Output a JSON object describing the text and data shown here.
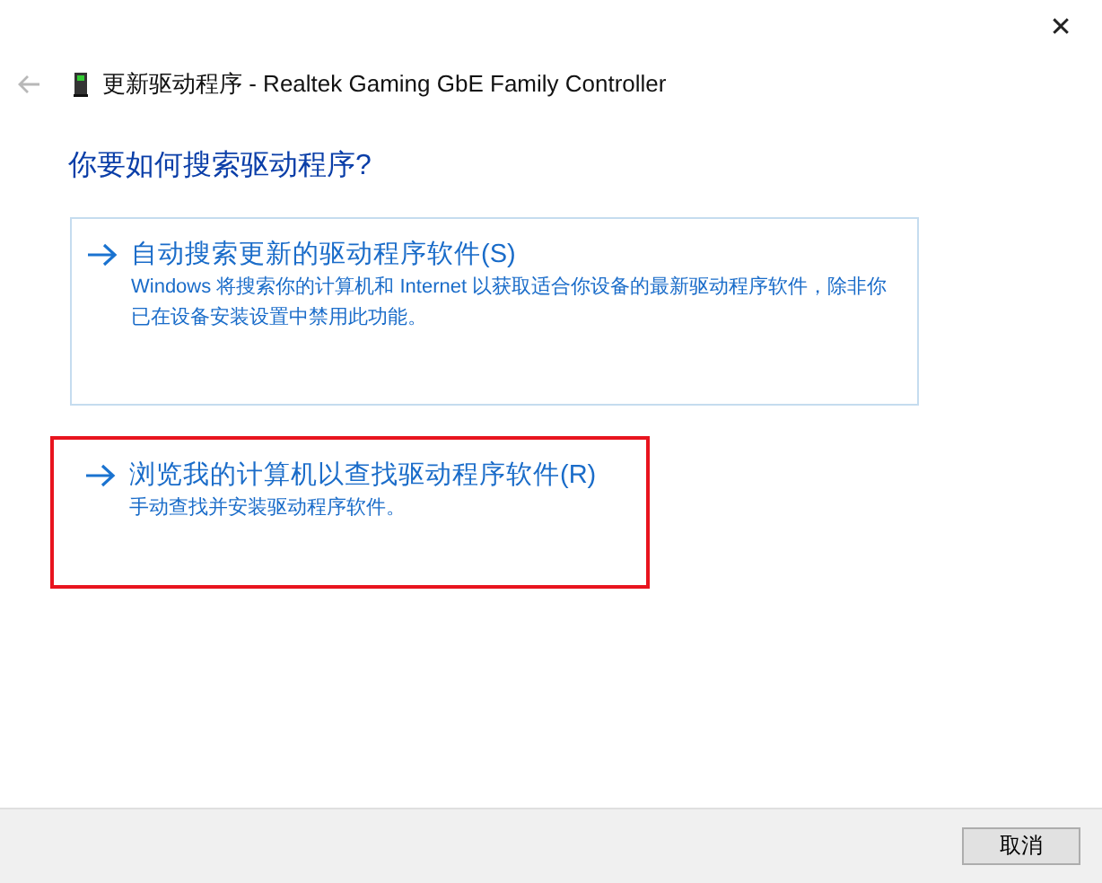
{
  "window": {
    "title": "更新驱动程序 - Realtek Gaming GbE Family Controller",
    "close": "✕"
  },
  "heading": "你要如何搜索驱动程序?",
  "options": [
    {
      "kind": "hover",
      "title": "自动搜索更新的驱动程序软件(S)",
      "description": "Windows 将搜索你的计算机和 Internet 以获取适合你设备的最新驱动程序软件，除非你已在设备安装设置中禁用此功能。"
    },
    {
      "kind": "marked",
      "title": "浏览我的计算机以查找驱动程序软件(R)",
      "description": "手动查找并安装驱动程序软件。"
    }
  ],
  "buttons": [
    "取消"
  ]
}
